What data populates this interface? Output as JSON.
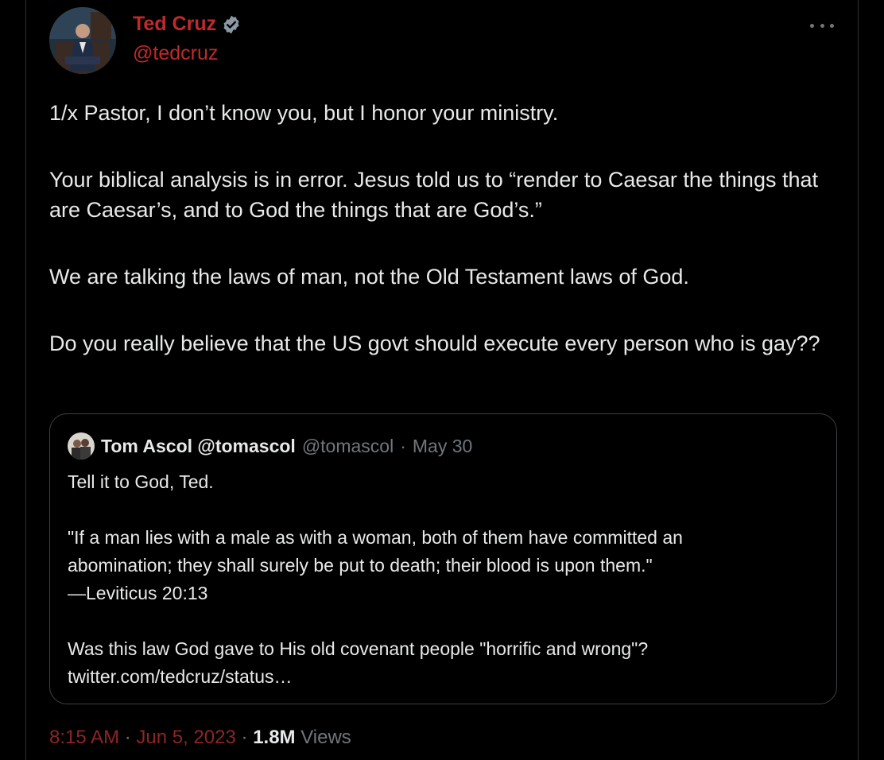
{
  "author": {
    "name": "Ted Cruz",
    "handle": "@tedcruz",
    "verified": true,
    "name_color": "#c02a2a"
  },
  "tweet": {
    "paragraphs": [
      "1/x Pastor, I don’t know you, but I honor your ministry.",
      "Your biblical analysis is in error. Jesus told us to “render to Caesar the things that are Caesar’s, and to God the things that are God’s.”",
      "We are talking the laws of man, not the Old Testament laws of God.",
      "Do you really believe that the US govt should execute every person who is gay??"
    ]
  },
  "quote": {
    "name": "Tom Ascol @tomascol",
    "handle": "@tomascol",
    "separator": "·",
    "date": "May 30",
    "paragraph1": "Tell it to God, Ted.",
    "paragraph2_lines": [
      "\"If a man lies with a male as with a woman, both of them have committed an",
      "abomination; they shall surely be put to death; their blood is upon them.\"",
      "—Leviticus 20:13"
    ],
    "paragraph3_lines": [
      "Was this law God gave to His old covenant people \"horrific and wrong\"?",
      "twitter.com/tedcruz/status…"
    ]
  },
  "meta": {
    "time": "8:15 AM",
    "separator": "·",
    "date": "Jun 5, 2023",
    "views_count": "1.8M",
    "views_label": "Views"
  },
  "icons": {
    "verified": "verified-badge-icon",
    "more": "more-options-icon"
  },
  "colors": {
    "background": "#000000",
    "text": "#e7e9ea",
    "muted": "#71767b",
    "accent_red": "#c02a2a",
    "border": "#2f3336"
  }
}
